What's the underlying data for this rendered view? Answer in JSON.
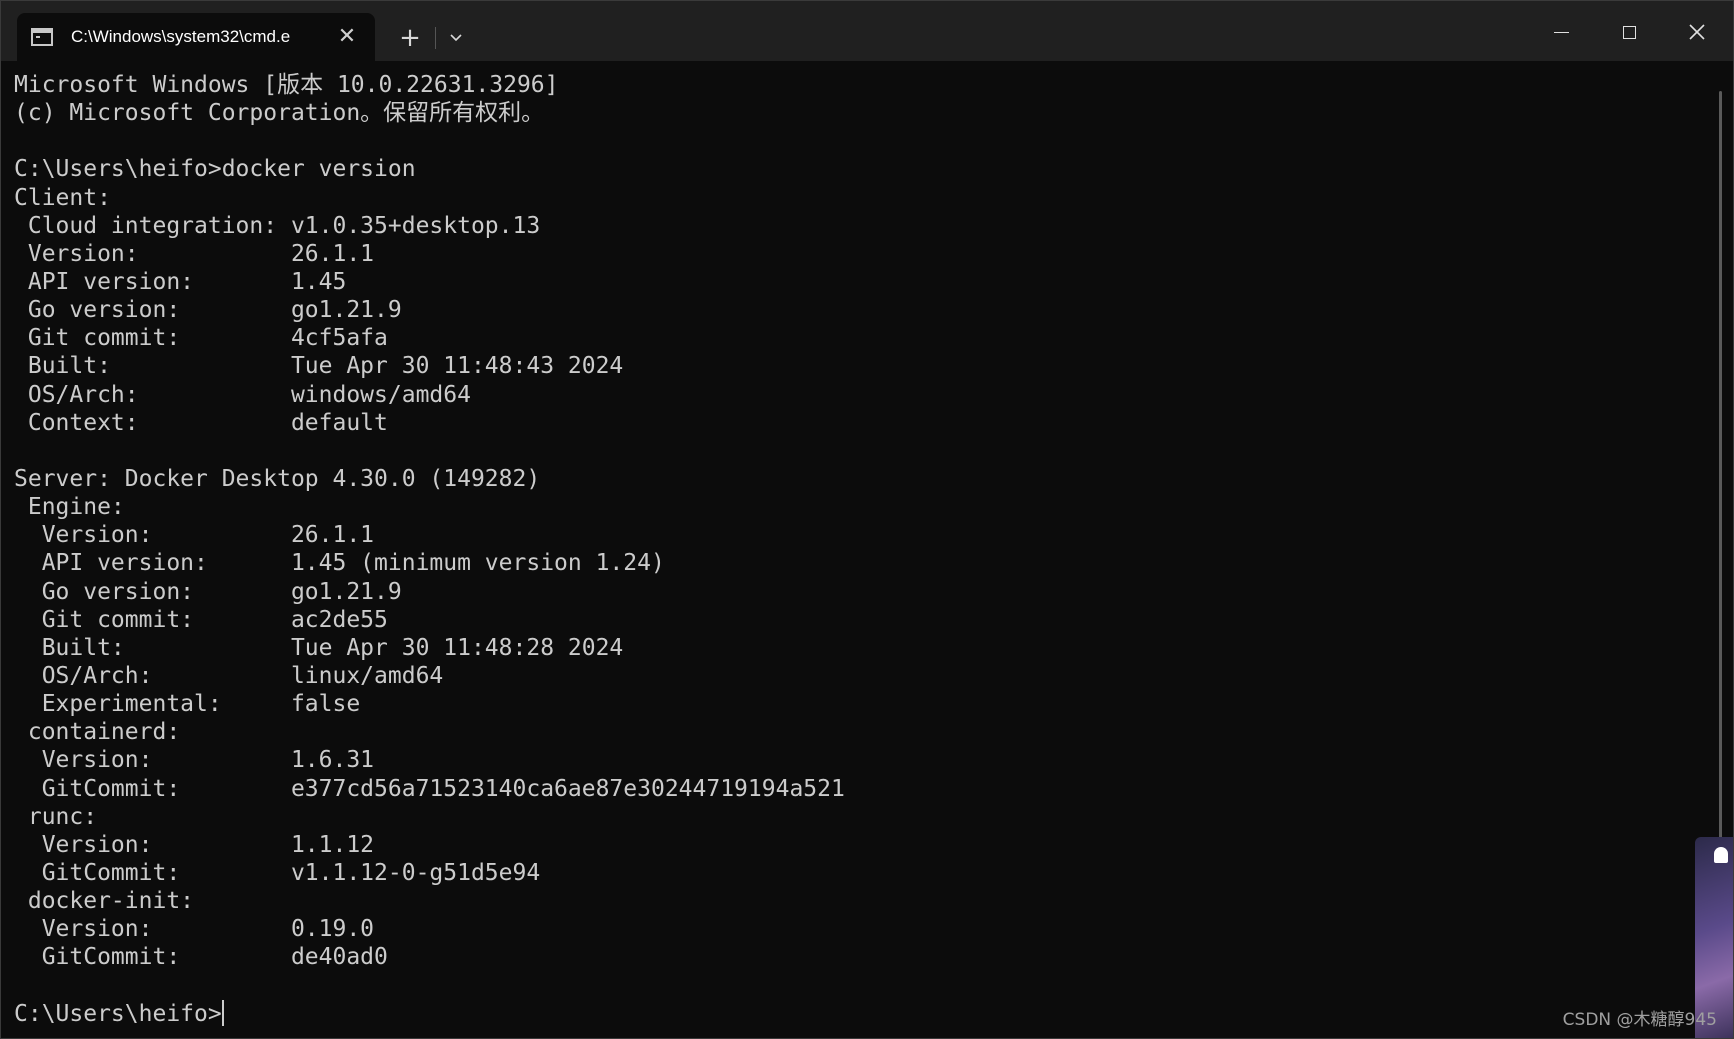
{
  "window": {
    "tab_title": "C:\\Windows\\system32\\cmd.e",
    "new_tab": "+",
    "close_tab": "✕",
    "close_window": "✕"
  },
  "console": {
    "lines": [
      "Microsoft Windows [版本 10.0.22631.3296]",
      "(c) Microsoft Corporation。保留所有权利。",
      "",
      "C:\\Users\\heifo>docker version",
      "Client:",
      " Cloud integration: v1.0.35+desktop.13",
      " Version:           26.1.1",
      " API version:       1.45",
      " Go version:        go1.21.9",
      " Git commit:        4cf5afa",
      " Built:             Tue Apr 30 11:48:43 2024",
      " OS/Arch:           windows/amd64",
      " Context:           default",
      "",
      "Server: Docker Desktop 4.30.0 (149282)",
      " Engine:",
      "  Version:          26.1.1",
      "  API version:      1.45 (minimum version 1.24)",
      "  Go version:       go1.21.9",
      "  Git commit:       ac2de55",
      "  Built:            Tue Apr 30 11:48:28 2024",
      "  OS/Arch:          linux/amd64",
      "  Experimental:     false",
      " containerd:",
      "  Version:          1.6.31",
      "  GitCommit:        e377cd56a71523140ca6ae87e30244719194a521",
      " runc:",
      "  Version:          1.1.12",
      "  GitCommit:        v1.1.12-0-g51d5e94",
      " docker-init:",
      "  Version:          0.19.0",
      "  GitCommit:        de40ad0",
      ""
    ],
    "prompt": "C:\\Users\\heifo>"
  },
  "watermark": "CSDN @木糖醇945",
  "colors": {
    "background": "#0c0c0c",
    "text": "#cccccc",
    "titlebar": "#202020"
  },
  "icons": {
    "tab": "terminal-icon",
    "new_tab": "plus-icon",
    "dropdown": "chevron-down-icon",
    "minimize": "minimize-icon",
    "maximize": "maximize-icon",
    "close": "close-icon"
  }
}
